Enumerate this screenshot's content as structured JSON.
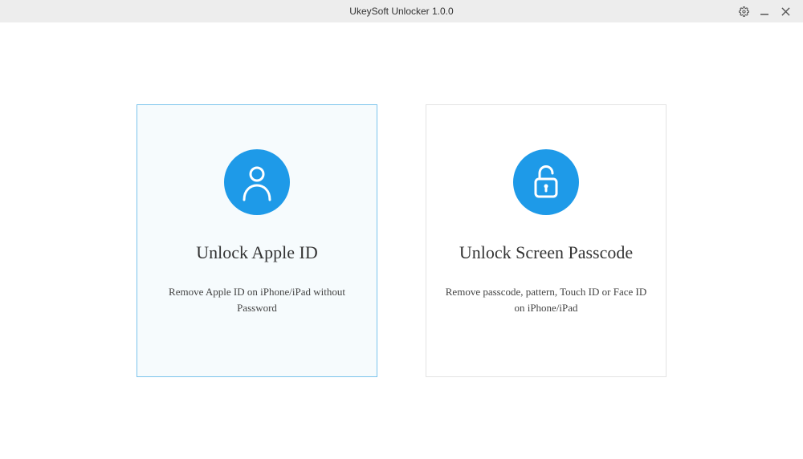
{
  "titlebar": {
    "title": "UkeySoft Unlocker 1.0.0"
  },
  "options": {
    "appleId": {
      "title": "Unlock Apple ID",
      "desc": "Remove Apple ID on iPhone/iPad without Password"
    },
    "screenPasscode": {
      "title": "Unlock Screen Passcode",
      "desc": "Remove passcode, pattern, Touch ID or Face ID on iPhone/iPad"
    }
  },
  "colors": {
    "accent": "#1e9ae8",
    "selectedBorder": "#7bc4ec",
    "selectedBg": "#f6fbfd"
  }
}
